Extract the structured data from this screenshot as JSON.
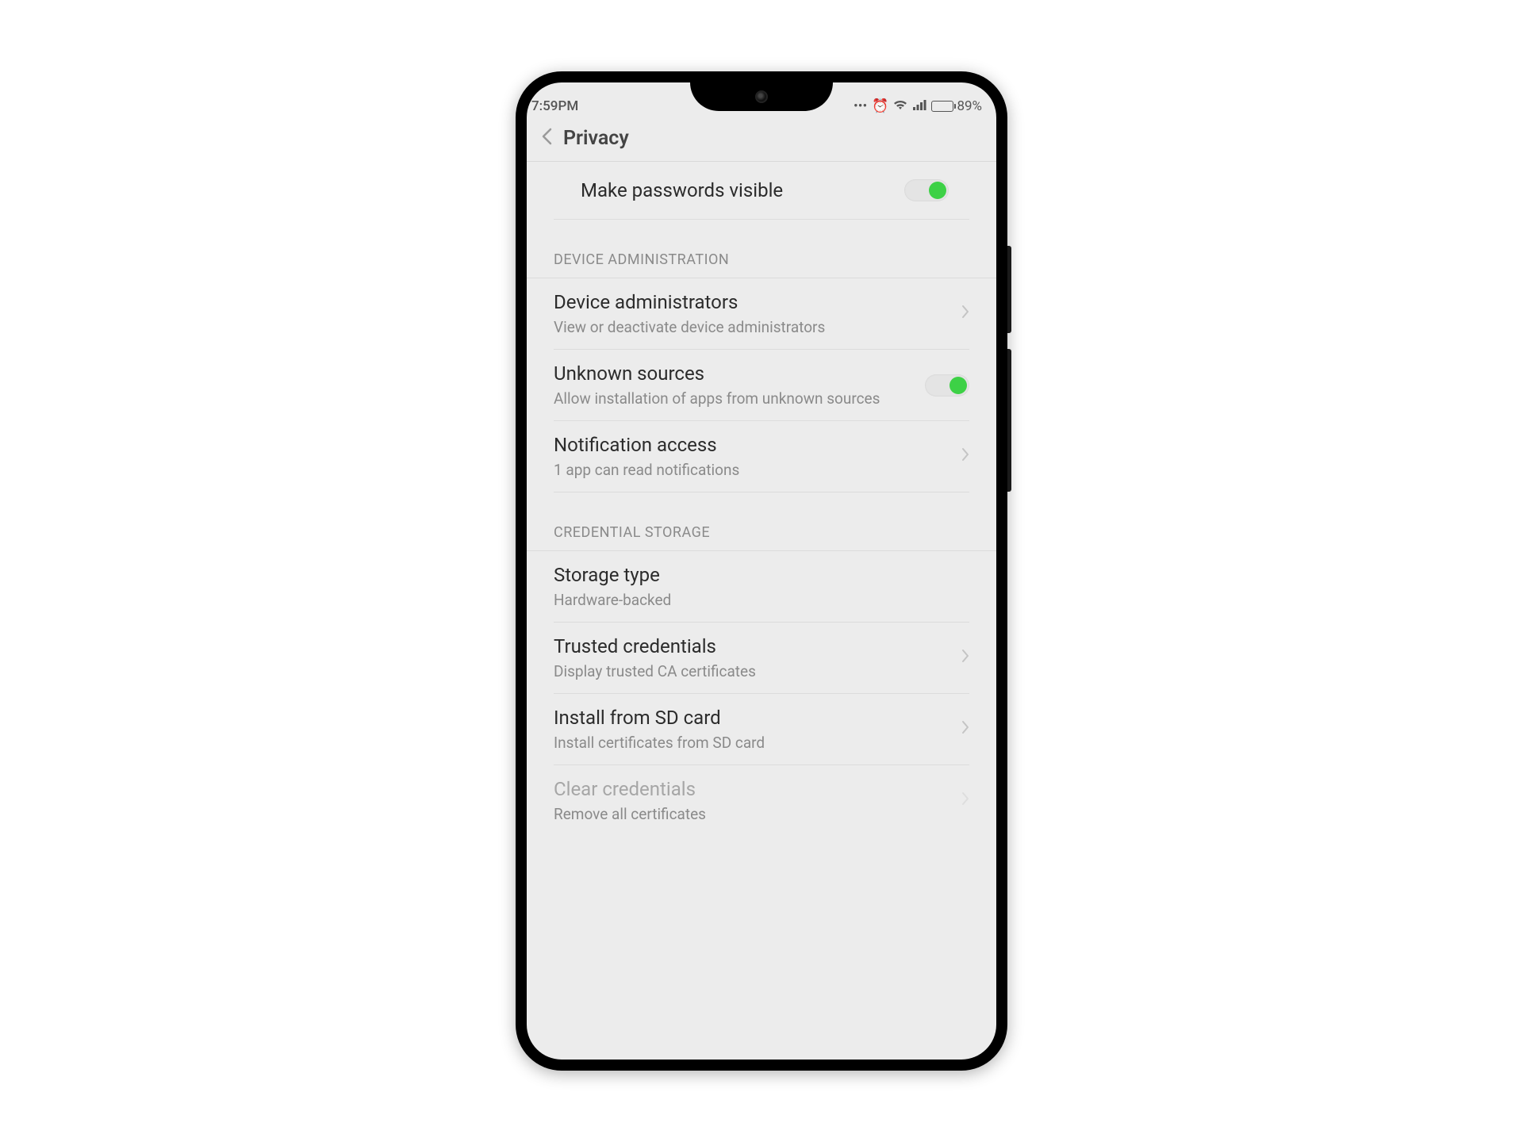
{
  "status": {
    "time": "7:59PM",
    "battery_pct": "89%"
  },
  "header": {
    "title": "Privacy"
  },
  "rows": {
    "passwords": {
      "title": "Make passwords visible"
    },
    "sectionDevice": "DEVICE ADMINISTRATION",
    "deviceAdmins": {
      "title": "Device administrators",
      "sub": "View or deactivate device administrators"
    },
    "unknown": {
      "title": "Unknown sources",
      "sub": "Allow installation of apps from unknown sources"
    },
    "notif": {
      "title": "Notification access",
      "sub": "1 app can read notifications"
    },
    "sectionCred": "CREDENTIAL STORAGE",
    "storage": {
      "title": "Storage type",
      "sub": "Hardware-backed"
    },
    "trusted": {
      "title": "Trusted credentials",
      "sub": "Display trusted CA certificates"
    },
    "install": {
      "title": "Install from SD card",
      "sub": "Install certificates from SD card"
    },
    "clear": {
      "title": "Clear credentials",
      "sub": "Remove all certificates"
    }
  }
}
